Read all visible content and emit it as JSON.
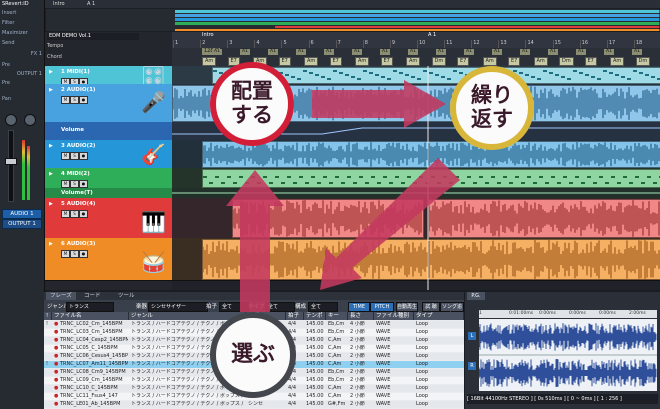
{
  "inspector": {
    "track_label": "SRevert:ID",
    "insert_label": "Insert",
    "filter_label": "Filter",
    "send_label": "Send",
    "send_slot": "Maximizer",
    "fx_label": "FX 1",
    "pre_label": "Pre",
    "output_label": "OUTPUT 1",
    "pan_label": "Pan",
    "pre2_label": "Pre",
    "audio_button": "AUDIO 1",
    "output_button": "OUTPUT 1"
  },
  "overview": {
    "intro": "Intro",
    "a1": "A 1"
  },
  "song": {
    "title": "EDM DEMO Vol.1",
    "tempo_label": "Tempo",
    "chord_label": "Chord"
  },
  "ruler": {
    "marks": [
      "1",
      "2",
      "3",
      "4",
      "5",
      "6",
      "7",
      "8",
      "9",
      "10",
      "11",
      "12",
      "13",
      "14",
      "15",
      "16",
      "17",
      "18"
    ],
    "intro_marker": "Intro",
    "a1_marker": "A 1",
    "tempo_value": "128.0"
  },
  "chords_top": [
    "A1",
    "A1",
    "A1",
    "A1",
    "A1",
    "A1",
    "A1",
    "A1",
    "A1",
    "A1",
    "A1",
    "A1",
    "A1",
    "A1",
    "A1",
    "A1"
  ],
  "chords": [
    "Am",
    "E7",
    "Am",
    "E7",
    "Am",
    "E7",
    "Am",
    "E7",
    "Am",
    "Dm",
    "E7",
    "Am",
    "E7",
    "Am",
    "Dm",
    "E7",
    "Am",
    "Dm"
  ],
  "tracks": [
    {
      "name": "1 MIDI(1)",
      "instrument": "🎛"
    },
    {
      "name": "2 AUDIO(1)",
      "instrument": "🎤"
    },
    {
      "name": "Volume",
      "instrument": ""
    },
    {
      "name": "3 AUDIO(2)",
      "instrument": "🎸"
    },
    {
      "name": "4 MIDI(2)",
      "instrument": "🎹"
    },
    {
      "name": "Volume(T)",
      "instrument": ""
    },
    {
      "name": "5 AUDIO(4)",
      "instrument": "🎹"
    },
    {
      "name": "6 AUDIO(3)",
      "instrument": "🥁"
    }
  ],
  "track_buttons": [
    "M",
    "S",
    "R",
    "●"
  ],
  "browser": {
    "tabs": [
      "フレーズ",
      "コード",
      "ツール"
    ],
    "genre_label": "ジャンル",
    "genre_value": "トランス",
    "instrument_label": "楽器",
    "instrument_value": "シンセサイザー",
    "beat_label": "拍子",
    "beat_value": "全て",
    "type_label": "タイプ",
    "type_value": "全て",
    "struct_label": "構成",
    "struct_value": "全て",
    "buttons": [
      "TIME",
      "PITCH",
      "自動再生",
      "試 聴",
      "ソング追加",
      "P.G."
    ],
    "columns": [
      "!",
      "ファイル名",
      "ジャンル",
      "楽器",
      "拍子",
      "テンポ",
      "キー",
      "長さ",
      "ファイル種別",
      "タイプ"
    ],
    "rows": [
      {
        "mark": "!",
        "name": "TRNC_LC02_Cm_145BPM",
        "genre": "トランス / ハードコアテクノ / テクノ / ポップス /",
        "inst": "シンセ",
        "beat": "4/4",
        "tempo": "145.00",
        "key": "Eb,Cm",
        "len": "4 小節",
        "ftype": "WAVE",
        "type": "Loop",
        "sel": false
      },
      {
        "mark": "",
        "name": "TRNC_LC03_Cm_145BPM",
        "genre": "トランス / ハードコアテクノ / テクノ / ポップス /",
        "inst": "シンセ",
        "beat": "4/4",
        "tempo": "145.00",
        "key": "Eb,Cm",
        "len": "2 小節",
        "ftype": "WAVE",
        "type": "Loop",
        "sel": false
      },
      {
        "mark": "",
        "name": "TRNC_LC04_Cesp2_145BPM",
        "genre": "トランス / ハードコアテクノ / テクノ / ポップス /",
        "inst": "シンセ",
        "beat": "4/4",
        "tempo": "145.00",
        "key": "C,Am",
        "len": "2 小節",
        "ftype": "WAVE",
        "type": "Loop",
        "sel": false
      },
      {
        "mark": "",
        "name": "TRNC_LC05_C_145BPM",
        "genre": "トランス / ハードコアテクノ / テクノ / ポップス /",
        "inst": "シンセ",
        "beat": "4/4",
        "tempo": "145.00",
        "key": "C,Am",
        "len": "2 小節",
        "ftype": "WAVE",
        "type": "Loop",
        "sel": false
      },
      {
        "mark": "",
        "name": "TRNC_LC06_Cesus4_145BPM",
        "genre": "トランス / ハードコアテクノ / テクノ / ポップス /",
        "inst": "シンセ",
        "beat": "4/4",
        "tempo": "145.00",
        "key": "C,Am",
        "len": "2 小節",
        "ftype": "WAVE",
        "type": "Loop",
        "sel": false
      },
      {
        "mark": "!",
        "name": "TRNC_LC07_Am11_145BPM",
        "genre": "トランス / ハードコアテクノ / テクノ / ポップス /",
        "inst": "シンセ",
        "beat": "4/4",
        "tempo": "145.00",
        "key": "C,Am",
        "len": "2 小節",
        "ftype": "WAVE",
        "type": "Loop",
        "sel": true
      },
      {
        "mark": "",
        "name": "TRNC_LC08_Cm9_145BPM",
        "genre": "トランス / ハードコアテクノ / テクノ / ポップス /",
        "inst": "シンセ",
        "beat": "4/4",
        "tempo": "145.00",
        "key": "Eb,Cm",
        "len": "2 小節",
        "ftype": "WAVE",
        "type": "Loop",
        "sel": false
      },
      {
        "mark": "",
        "name": "TRNC_LC09_Cm_145BPM",
        "genre": "トランス / ハードコアテクノ / テクノ / ポップス /",
        "inst": "シンセ",
        "beat": "4/4",
        "tempo": "145.00",
        "key": "Eb,Cm",
        "len": "2 小節",
        "ftype": "WAVE",
        "type": "Loop",
        "sel": false
      },
      {
        "mark": "",
        "name": "TRNC_LC10_C_145BPM",
        "genre": "トランス / ハードコアテクノ / テクノ / ポップス /",
        "inst": "シンセ",
        "beat": "4/4",
        "tempo": "145.00",
        "key": "C,Am",
        "len": "2 小節",
        "ftype": "WAVE",
        "type": "Loop",
        "sel": false
      },
      {
        "mark": "",
        "name": "TRNC_LC11_Fsus4_147",
        "genre": "トランス / ハードコアテクノ / テクノ / ポップス /",
        "inst": "シンセ",
        "beat": "4/4",
        "tempo": "145.00",
        "key": "C,Am",
        "len": "2 小節",
        "ftype": "WAVE",
        "type": "Loop",
        "sel": false
      },
      {
        "mark": "",
        "name": "TRNC_LE01_Ab_145BPM",
        "genre": "トランス / ハードコアテクノ / テクノ / ポップス /",
        "inst": "シンセ",
        "beat": "4/4",
        "tempo": "145.00",
        "key": "G#,Fm",
        "len": "2 小節",
        "ftype": "WAVE",
        "type": "Loop",
        "sel": false
      }
    ]
  },
  "preview": {
    "ruler": [
      "1",
      "0:01:00ms",
      "0:00ms",
      "0:00ms",
      "0:00ms",
      "2:00ms"
    ],
    "channel_l": "L",
    "channel_r": "R",
    "status": "[ 16Bit  44100Hz  STEREO ]  [ 0s 510ms ]  [ 0 ~ 0ms ]  [ 1 : 256 ]"
  },
  "callouts": {
    "place": "配置\nする",
    "repeat": "繰り\n返す",
    "choose": "選ぶ"
  },
  "colors": {
    "midi_track": "#4fc4d6",
    "audio_track": "#49a2e0",
    "audio3": "#2596d8",
    "midi2": "#2fae5a",
    "audio4": "#e03a3a",
    "audio5": "#ef8c25",
    "arrow": "#c4395f",
    "ring_red": "#d21f37",
    "ring_gold": "#d7b63a",
    "ring_dark": "#43464d"
  }
}
